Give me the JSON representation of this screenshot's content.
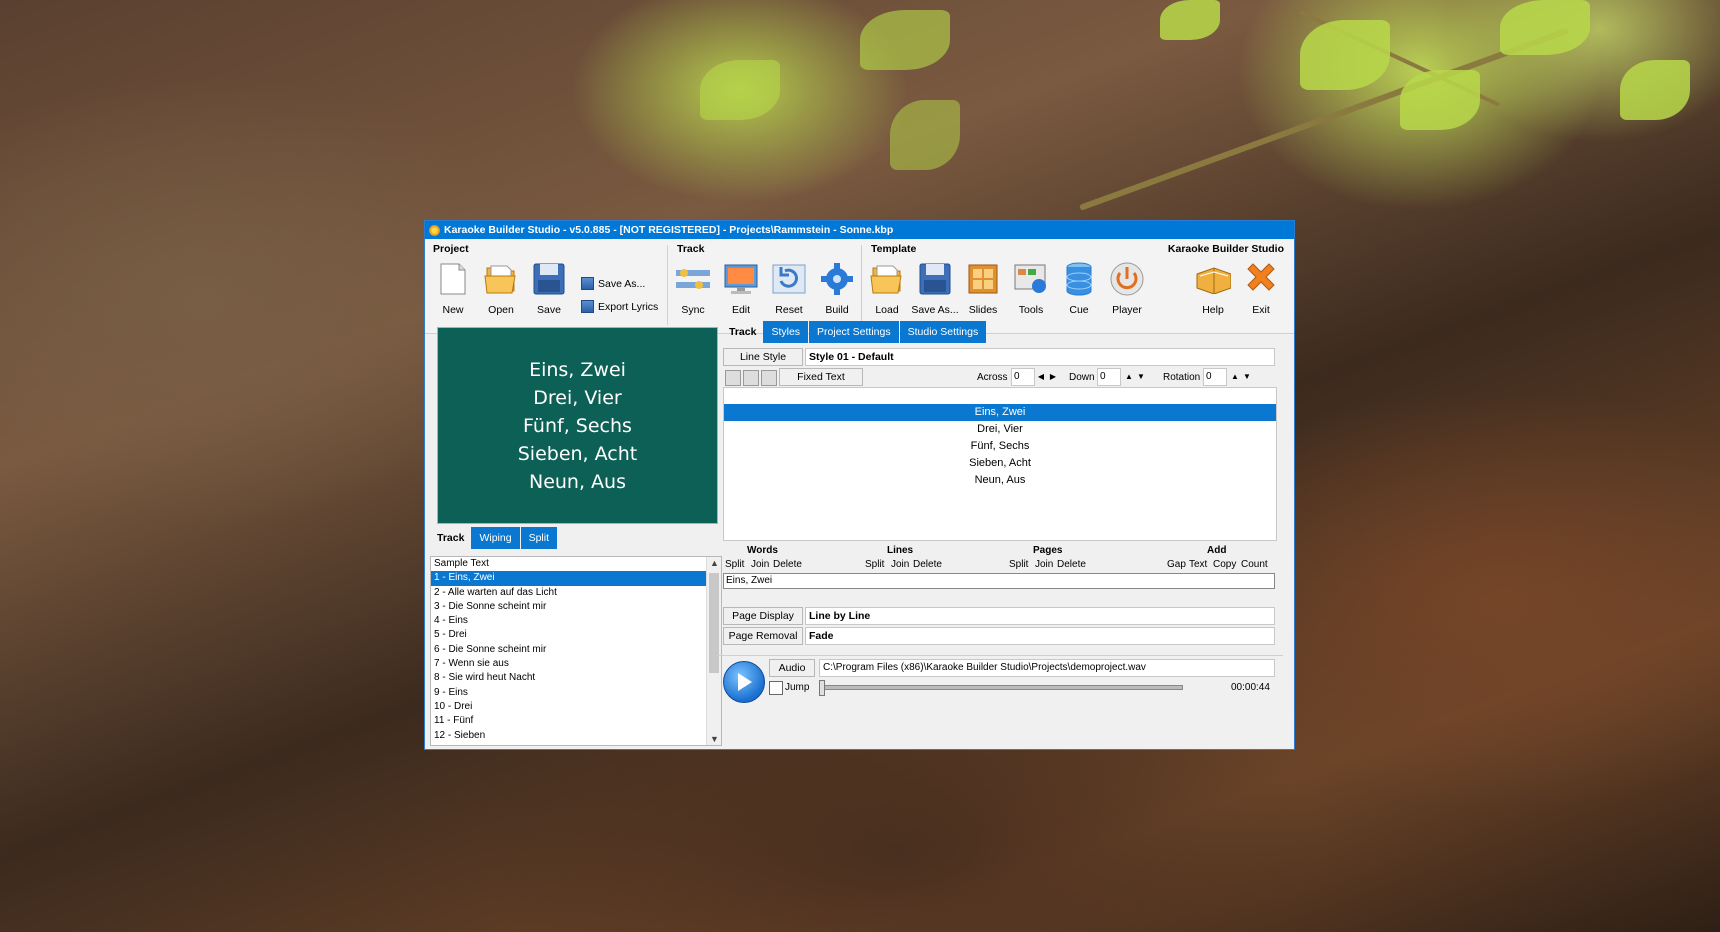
{
  "window": {
    "title": "Karaoke Builder Studio - v5.0.885 - [NOT REGISTERED] - Projects\\Rammstein - Sonne.kbp"
  },
  "ribbon": {
    "project": {
      "title": "Project",
      "new": "New",
      "open": "Open",
      "save": "Save",
      "save_as": "Save As...",
      "export_lyrics": "Export Lyrics"
    },
    "track": {
      "title": "Track",
      "sync": "Sync",
      "edit": "Edit",
      "reset": "Reset",
      "build": "Build"
    },
    "template": {
      "title": "Template",
      "load": "Load",
      "save_as": "Save As...",
      "slides": "Slides",
      "tools": "Tools",
      "cue": "Cue",
      "player": "Player"
    },
    "brand": {
      "title": "Karaoke Builder Studio",
      "help": "Help",
      "exit": "Exit"
    }
  },
  "preview": {
    "lines": [
      "Eins, Zwei",
      "Drei, Vier",
      "Fünf, Sechs",
      "Sieben, Acht",
      "Neun, Aus"
    ]
  },
  "left_tabs": {
    "label": "Track",
    "tabs": [
      "Wiping",
      "Split"
    ]
  },
  "track_list": {
    "items": [
      "Sample Text",
      "1 - Eins, Zwei",
      "2 - Alle warten auf das Licht",
      "3 - Die Sonne scheint mir",
      "4 - Eins",
      "5 - Drei",
      "6 - Die Sonne scheint mir",
      "7 - Wenn sie aus",
      "8 - Sie wird heut Nacht",
      "9 - Eins",
      "10 - Drei",
      "11 - Fünf",
      "12 - Sieben"
    ],
    "selected_index": 1
  },
  "right_tabs": {
    "label": "Track",
    "tabs": [
      "Styles",
      "Project Settings",
      "Studio Settings"
    ]
  },
  "line_style": {
    "label": "Line Style",
    "value": "Style 01 - Default"
  },
  "fixed_text": "Fixed Text",
  "offsets": {
    "across_label": "Across",
    "across": "0",
    "down_label": "Down",
    "down": "0",
    "rotation_label": "Rotation",
    "rotation": "0"
  },
  "lines": {
    "items": [
      "Eins, Zwei",
      "Drei, Vier",
      "Fünf, Sechs",
      "Sieben, Acht",
      "Neun, Aus"
    ],
    "selected_index": 0
  },
  "edit_groups": {
    "words": {
      "title": "Words",
      "split": "Split",
      "join": "Join",
      "delete": "Delete"
    },
    "lines": {
      "title": "Lines",
      "split": "Split",
      "join": "Join",
      "delete": "Delete"
    },
    "pages": {
      "title": "Pages",
      "split": "Split",
      "join": "Join",
      "delete": "Delete"
    },
    "add": {
      "title": "Add",
      "gap": "Gap",
      "text": "Text",
      "copy": "Copy",
      "count": "Count"
    }
  },
  "word_edit": "Eins,  Zwei",
  "page_display": {
    "label": "Page Display",
    "value": "Line by Line"
  },
  "page_removal": {
    "label": "Page Removal",
    "value": "Fade"
  },
  "audio": {
    "label": "Audio",
    "path": "C:\\Program Files (x86)\\Karaoke Builder Studio\\Projects\\demoproject.wav",
    "jump": "Jump",
    "time": "00:00:44"
  },
  "colors": {
    "accent": "#0078d7",
    "preview_bg": "#0c6055"
  }
}
